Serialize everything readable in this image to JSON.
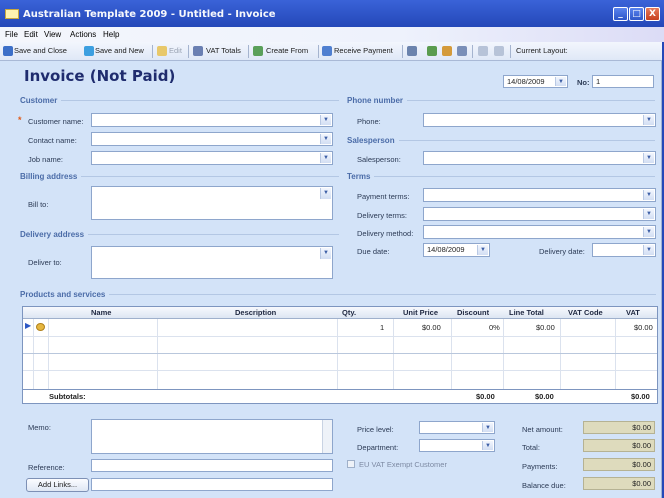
{
  "window": {
    "title": "Australian Template 2009 - Untitled - Invoice",
    "minimize": "_",
    "maximize": "□",
    "close": "X"
  },
  "menu": [
    "File",
    "Edit",
    "View",
    "Actions",
    "Help"
  ],
  "toolbar": {
    "save_close": "Save and Close",
    "save_new": "Save and New",
    "edit": "Edit",
    "vat_totals": "VAT Totals",
    "create_from": "Create From",
    "receive_payment": "Receive Payment",
    "current_layout": "Current Layout:"
  },
  "header": {
    "title": "Invoice (Not Paid)",
    "date": "14/08/2009",
    "no_label": "No:",
    "no_value": "1"
  },
  "customer": {
    "section": "Customer",
    "customer_name_label": "Customer name:",
    "contact_name_label": "Contact name:",
    "job_name_label": "Job name:"
  },
  "billing": {
    "section": "Billing address",
    "bill_to_label": "Bill to:"
  },
  "delivery": {
    "section": "Delivery address",
    "deliver_to_label": "Deliver to:"
  },
  "phone": {
    "section": "Phone number",
    "phone_label": "Phone:"
  },
  "salesperson": {
    "section": "Salesperson",
    "label": "Salesperson:"
  },
  "terms": {
    "section": "Terms",
    "payment_terms_label": "Payment terms:",
    "delivery_terms_label": "Delivery terms:",
    "delivery_method_label": "Delivery method:",
    "due_date_label": "Due date:",
    "due_date_value": "14/08/2009",
    "delivery_date_label": "Delivery date:"
  },
  "products": {
    "section": "Products and services",
    "columns": [
      "Name",
      "Description",
      "Qty.",
      "Unit Price",
      "Discount",
      "Line Total",
      "VAT Code",
      "VAT"
    ],
    "row": {
      "qty": "1",
      "unit_price": "$0.00",
      "discount": "0%",
      "line_total": "$0.00",
      "vat": "$0.00"
    },
    "subtotals_label": "Subtotals:",
    "subtotal_discount": "$0.00",
    "subtotal_line_total": "$0.00",
    "subtotal_vat": "$0.00"
  },
  "footer": {
    "memo_label": "Memo:",
    "reference_label": "Reference:",
    "add_links": "Add Links...",
    "price_level_label": "Price level:",
    "department_label": "Department:",
    "eu_vat_label": "EU VAT Exempt Customer",
    "net_amount_label": "Net amount:",
    "net_amount": "$0.00",
    "total_label": "Total:",
    "total": "$0.00",
    "payments_label": "Payments:",
    "payments": "$0.00",
    "balance_due_label": "Balance due:",
    "balance_due": "$0.00"
  },
  "colors": {
    "title_bar": "#2448b8",
    "form_bg": "#d3e3f8",
    "heading": "#1f2c6e",
    "section": "#4b6ca8",
    "required": "#e05a18"
  }
}
